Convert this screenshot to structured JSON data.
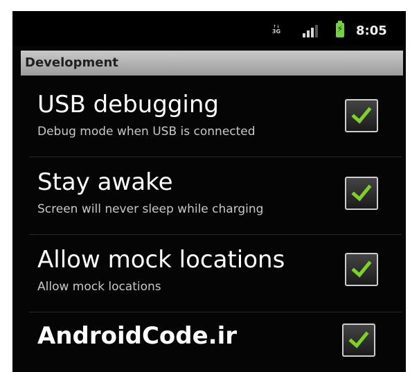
{
  "status_bar": {
    "network_icon": "3g-icon",
    "network_label": "3G",
    "signal_icon": "signal-strength-icon",
    "battery_icon": "battery-charging-icon",
    "time": "8:05"
  },
  "header": {
    "title": "Development"
  },
  "preferences": [
    {
      "title": "USB debugging",
      "summary": "Debug mode when USB is connected",
      "checked": true
    },
    {
      "title": "Stay awake",
      "summary": "Screen will never sleep while charging",
      "checked": true
    },
    {
      "title": "Allow mock locations",
      "summary": "Allow mock locations",
      "checked": true
    },
    {
      "title": "AndroidCode.ir",
      "summary": "",
      "checked": true
    }
  ],
  "colors": {
    "background": "#050505",
    "header_bg": "#b3b3b3",
    "check_green": "#7ed321"
  }
}
